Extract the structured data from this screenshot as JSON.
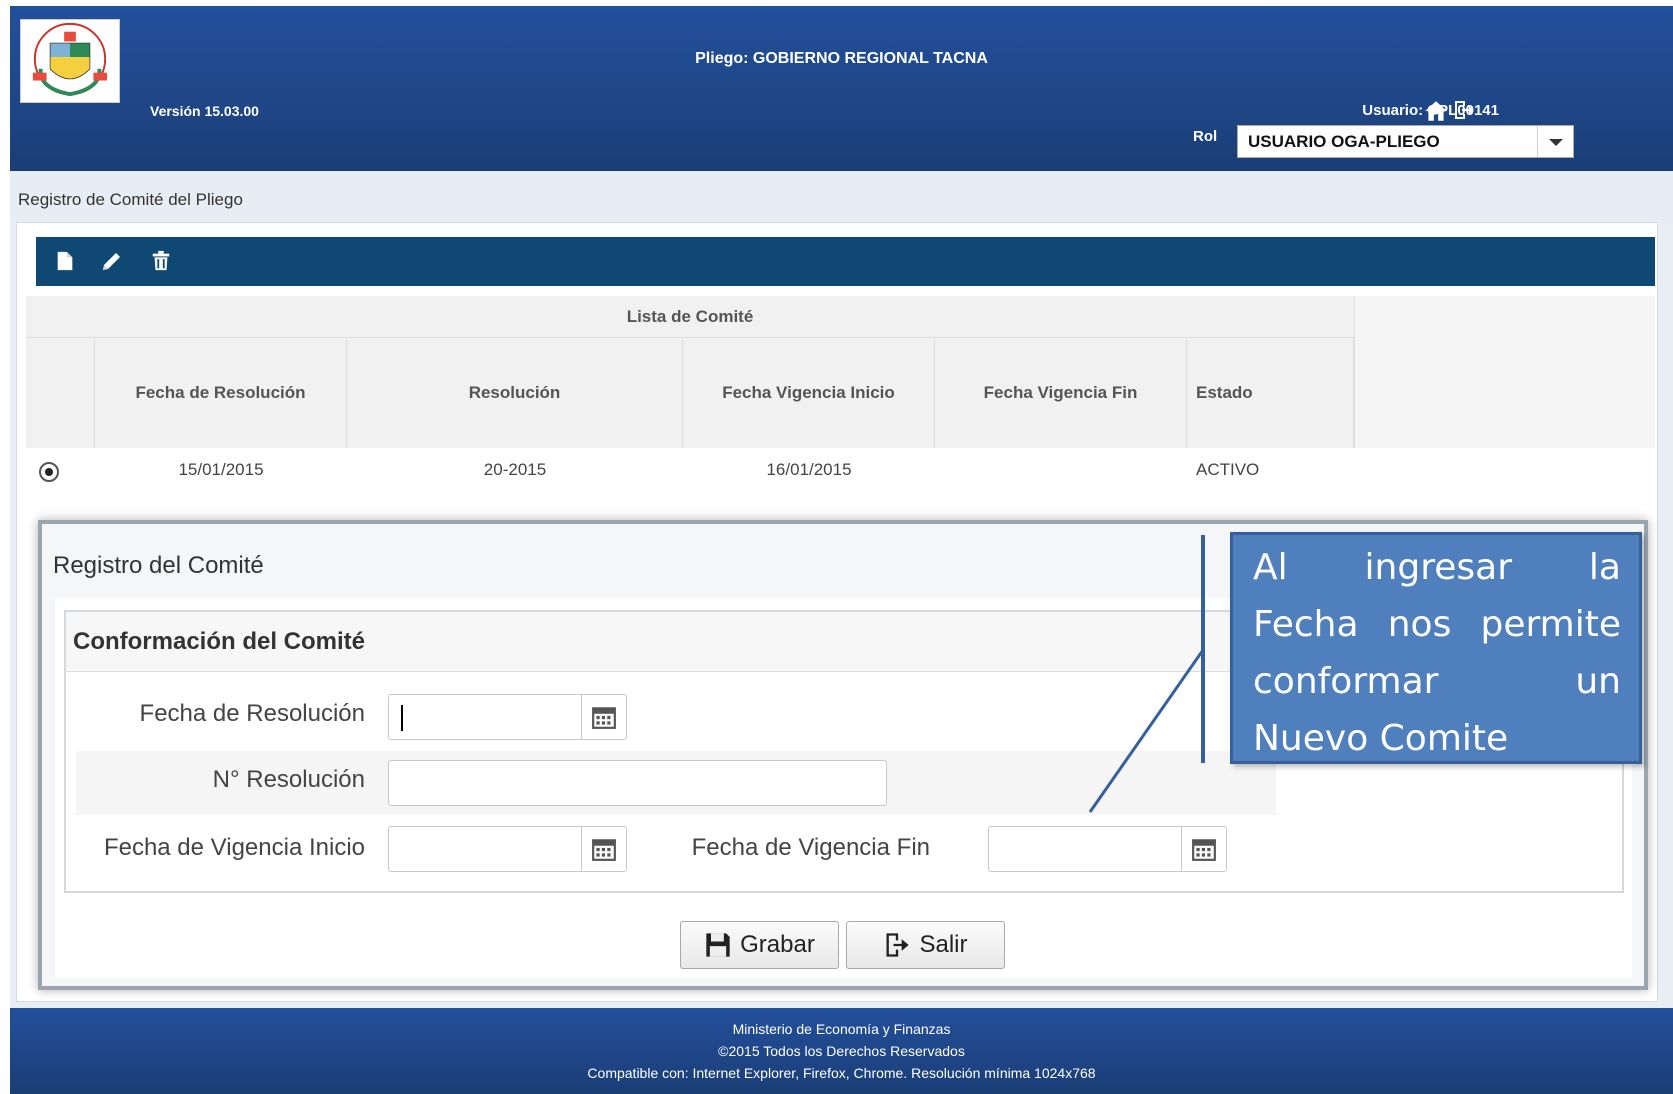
{
  "header": {
    "pliego": "Pliego: GOBIERNO REGIONAL TACNA",
    "version": "Versión 15.03.00",
    "usuario": "Usuario: CPL00141",
    "rol_label": "Rol",
    "rol_value": "USUARIO OGA-PLIEGO",
    "icons": [
      "home-icon",
      "logout-icon"
    ]
  },
  "breadcrumb": "Registro de Comité del Pliego",
  "toolbar": {
    "icons": [
      "new-document-icon",
      "edit-pencil-icon",
      "delete-trash-icon"
    ]
  },
  "grid": {
    "title": "Lista de Comité",
    "columns": [
      "Fecha de Resolución",
      "Resolución",
      "Fecha Vigencia Inicio",
      "Fecha Vigencia Fin",
      "Estado"
    ],
    "rows": [
      {
        "fecha_resolucion": "15/01/2015",
        "resolucion": "20-2015",
        "vigencia_inicio": "16/01/2015",
        "vigencia_fin": "",
        "estado": "ACTIVO"
      }
    ]
  },
  "dialog": {
    "title": "Registro del Comité",
    "section_title": "Conformación del Comité",
    "fields": {
      "fecha_resolucion": {
        "label": "Fecha de Resolución",
        "value": ""
      },
      "nro_resolucion": {
        "label": "N° Resolución",
        "value": ""
      },
      "vigencia_inicio": {
        "label": "Fecha de Vigencia Inicio",
        "value": ""
      },
      "vigencia_fin": {
        "label": "Fecha de Vigencia Fin",
        "value": ""
      }
    },
    "buttons": {
      "grabar": "Grabar",
      "salir": "Salir"
    }
  },
  "callout": {
    "lines": [
      "Al ingresar la",
      "Fecha nos permite",
      "conformar un",
      "Nuevo Comite"
    ]
  },
  "footer": {
    "line1": "Ministerio de Economía y Finanzas",
    "line2": "©2015 Todos los Derechos Reservados",
    "line3": "Compatible con: Internet Explorer, Firefox, Chrome. Resolución mínima 1024x768"
  },
  "colors": {
    "header_blue": "#1f4788",
    "toolbar_blue": "#0f4873",
    "callout_blue": "#4f80bd"
  }
}
